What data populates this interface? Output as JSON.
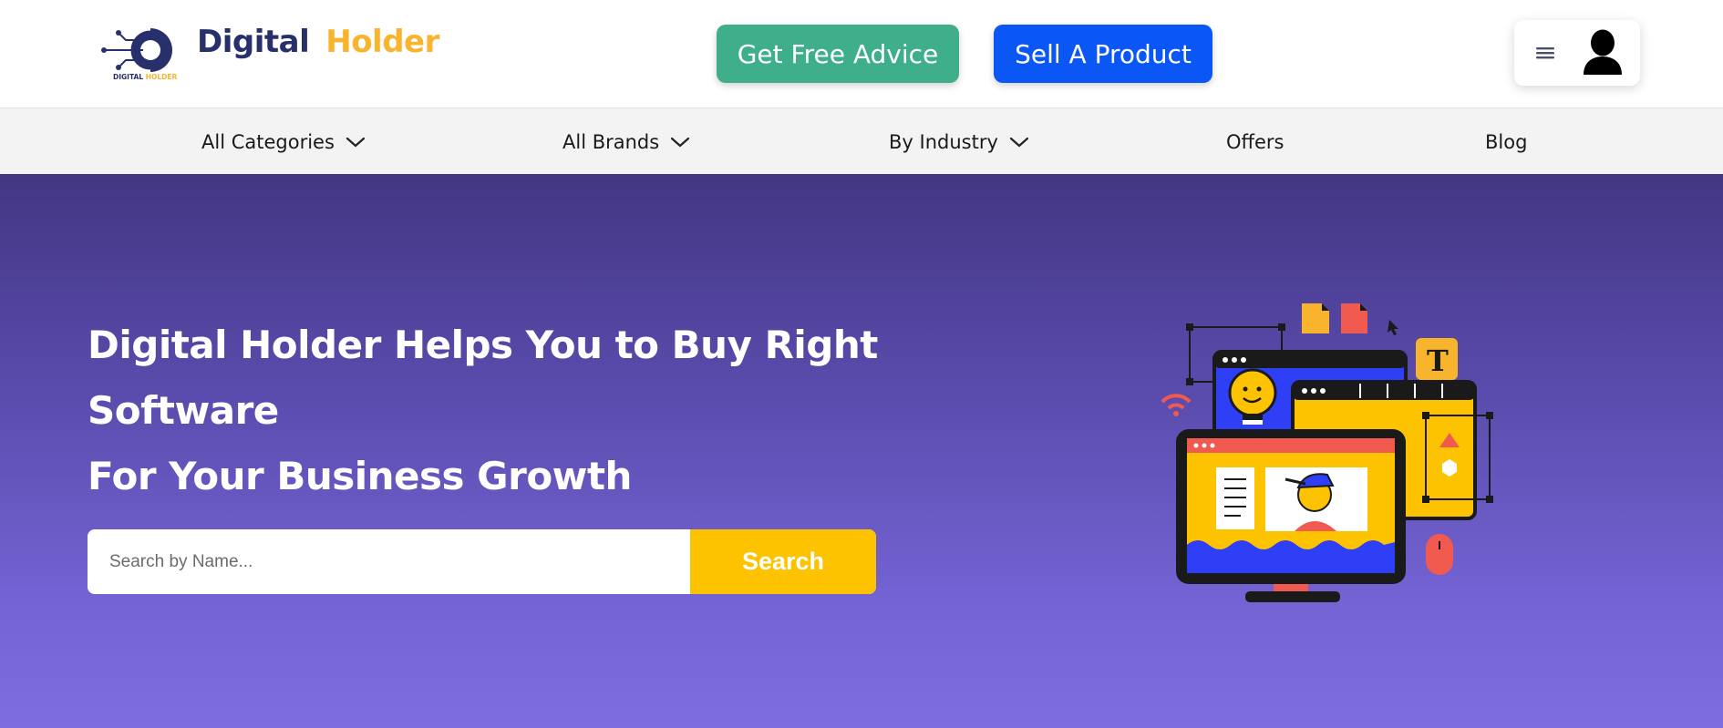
{
  "header": {
    "brand_part1": "Digital",
    "brand_part2": "Holder",
    "logo_caption_part1": "DIGITAL",
    "logo_caption_part2": "HOLDER",
    "advice_button": "Get Free Advice",
    "sell_button": "Sell A Product",
    "menu_icon": "hamburger-icon",
    "avatar_icon": "user-icon"
  },
  "nav": {
    "items": [
      {
        "label": "All Categories",
        "has_dropdown": true
      },
      {
        "label": "All Brands",
        "has_dropdown": true
      },
      {
        "label": "By Industry",
        "has_dropdown": true
      },
      {
        "label": "Offers",
        "has_dropdown": false
      },
      {
        "label": "Blog",
        "has_dropdown": false
      }
    ]
  },
  "hero": {
    "title_line1": "Digital Holder Helps You to Buy Right Software",
    "title_line2": "For Your Business Growth",
    "search_placeholder": "Search by Name...",
    "search_button": "Search",
    "illustration": "monitor-workspace-illustration"
  },
  "colors": {
    "brand_dark": "#27306b",
    "brand_accent": "#f7b42c",
    "advice_green": "#3fae8a",
    "sell_blue": "#0b57f5",
    "search_yellow": "#fdc300",
    "hero_top": "#433683",
    "hero_bottom": "#7d6de0",
    "nav_bg": "#f3f3f3"
  }
}
